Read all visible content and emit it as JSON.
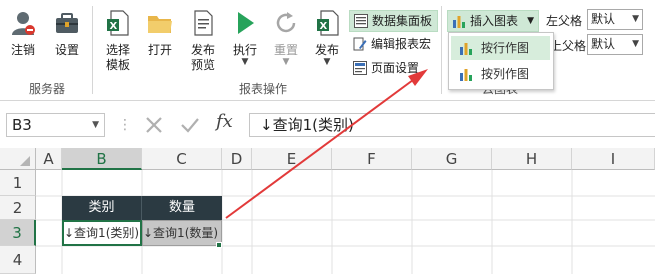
{
  "ribbon": {
    "buttons": {
      "logout": "注销",
      "settings": "设置",
      "select_template": "选择\n模板",
      "open": "打开",
      "publish_preview": "发布\n预览",
      "execute": "执行",
      "reset": "重置",
      "publish": "发布"
    },
    "small": {
      "dataset_panel": "数据集面板",
      "edit_macro": "编辑报表宏",
      "page_setup": "页面设置",
      "insert_chart": "插入图表"
    },
    "groups": {
      "server": "服务器",
      "report_ops": "报表操作",
      "cloud_chart": "云图表"
    },
    "left_parent": {
      "label1": "左父格",
      "label2": "上父格",
      "value1": "默认",
      "value2": "默认"
    },
    "chart_menu": {
      "items": [
        "按行作图",
        "按列作图"
      ]
    }
  },
  "formula_bar": {
    "name_box": "B3",
    "fx": "fx",
    "formula": "↓查询1(类别)"
  },
  "sheet": {
    "columns": [
      "A",
      "B",
      "C",
      "D",
      "E",
      "F",
      "G",
      "H",
      "I"
    ],
    "rows": [
      "1",
      "2",
      "3",
      "4"
    ],
    "header_cells": [
      "类别",
      "数量"
    ],
    "data_cells": [
      "↓查询1(类别)",
      "↓查询1(数量)"
    ]
  },
  "colors": {
    "accent": "#217346",
    "header_fill": "#2b3a42",
    "arrow": "#e23a3a",
    "active_button": "#cfe8d6"
  }
}
